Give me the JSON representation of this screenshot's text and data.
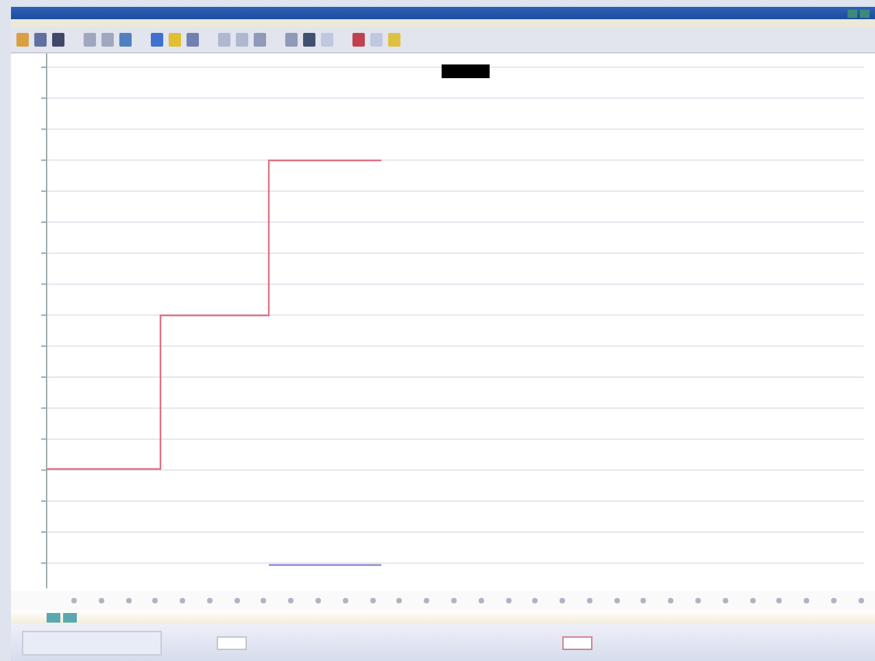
{
  "plot": {
    "traces": [
      {
        "kind": "step",
        "color": "#e07080"
      },
      {
        "kind": "flat",
        "color": "#8a8ac8"
      }
    ]
  }
}
